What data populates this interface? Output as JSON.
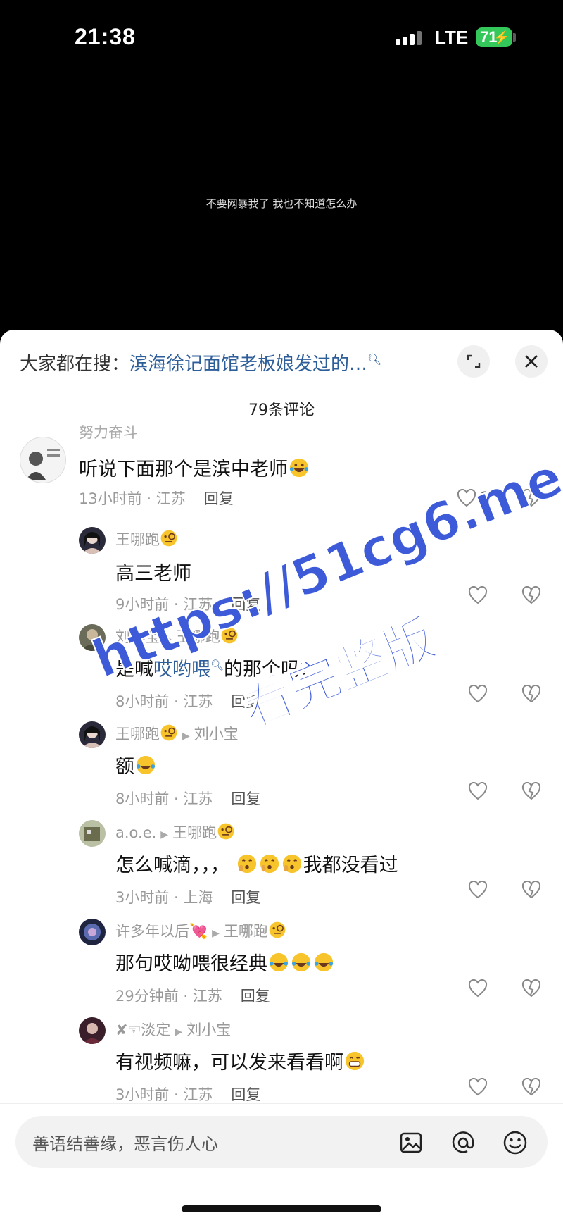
{
  "status": {
    "time": "21:38",
    "network": "LTE",
    "battery": "71"
  },
  "video": {
    "subtitle": "不要网暴我了 我也不知道怎么办"
  },
  "search": {
    "label": "大家都在搜：",
    "query": "滨海徐记面馆老板娘发过的…"
  },
  "comments_count": "79条评论",
  "comments": [
    {
      "name": "努力奋斗",
      "reply_to": "",
      "text": "听说下面那个是滨中老师",
      "time": "13小时前 · 江苏",
      "reply": "回复",
      "likes": "1"
    },
    {
      "name": "王哪跑",
      "reply_to": "",
      "text": "高三老师",
      "time": "9小时前 · 江苏",
      "reply": "回复",
      "likes": ""
    },
    {
      "name": "刘小宝",
      "reply_to": "王哪跑",
      "text_pre": "是喊",
      "text_link": "哎哟喂",
      "text_post": "的那个吗?",
      "time": "8小时前 · 江苏",
      "reply": "回复",
      "likes": ""
    },
    {
      "name": "王哪跑",
      "reply_to": "刘小宝",
      "text": "额",
      "time": "8小时前 · 江苏",
      "reply": "回复",
      "likes": ""
    },
    {
      "name": "a.o.e.",
      "reply_to": "王哪跑",
      "text_pre": "怎么喊滴，，，",
      "text_post": "我都没看过",
      "time": "3小时前 · 上海",
      "reply": "回复",
      "likes": ""
    },
    {
      "name": "许多年以后",
      "reply_to": "王哪跑",
      "text": "那句哎呦喂很经典",
      "time": "29分钟前 · 江苏",
      "reply": "回复",
      "likes": ""
    },
    {
      "name": "✘☜淡定",
      "reply_to": "刘小宝",
      "text": "有视频嘛，可以发来看看啊",
      "time": "3小时前 · 江苏",
      "reply": "回复",
      "likes": ""
    }
  ],
  "input": {
    "placeholder": "善语结善缘，恶言伤人心"
  },
  "watermark": {
    "line1": "https://51cg6.me",
    "line2": "看完整版"
  },
  "colors": {
    "link": "#2d5e9a",
    "battery": "#34c759",
    "watermark": "#3d5bd9"
  }
}
